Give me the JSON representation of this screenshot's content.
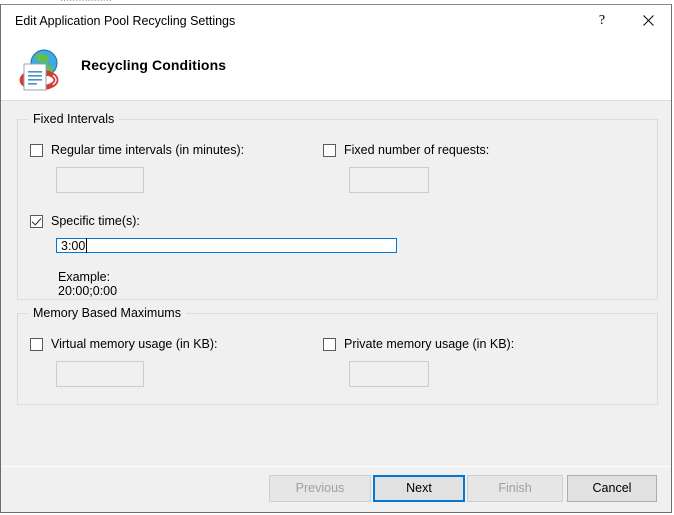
{
  "window": {
    "title": "Edit Application Pool Recycling Settings",
    "help_icon": "question-mark-icon",
    "help_glyph": "?",
    "close_icon": "close-icon"
  },
  "header": {
    "icon": "recycling-globe-document-icon",
    "heading": "Recycling Conditions"
  },
  "groups": [
    {
      "key": "fixed_intervals",
      "title": "Fixed Intervals",
      "fields": [
        {
          "key": "regular_time_intervals",
          "label": "Regular time intervals (in minutes):",
          "checked": false,
          "value": "",
          "enabled": false
        },
        {
          "key": "fixed_number_of_requests",
          "label": "Fixed number of requests:",
          "checked": false,
          "value": "",
          "enabled": false
        },
        {
          "key": "specific_times",
          "label": "Specific time(s):",
          "checked": true,
          "value": "3:00",
          "enabled": true,
          "hint": "Example: 20:00;0:00"
        }
      ]
    },
    {
      "key": "memory_based_maximums",
      "title": "Memory Based Maximums",
      "fields": [
        {
          "key": "virtual_memory_usage",
          "label": "Virtual memory usage (in KB):",
          "checked": false,
          "value": "",
          "enabled": false
        },
        {
          "key": "private_memory_usage",
          "label": "Private memory usage (in KB):",
          "checked": false,
          "value": "",
          "enabled": false
        }
      ]
    }
  ],
  "footer": {
    "previous": "Previous",
    "next": "Next",
    "finish": "Finish",
    "cancel": "Cancel"
  },
  "colors": {
    "accent": "#0078d7",
    "dialog_background": "#f0f0f0",
    "header_background": "#ffffff",
    "disabled_text": "#a0a0a0"
  }
}
